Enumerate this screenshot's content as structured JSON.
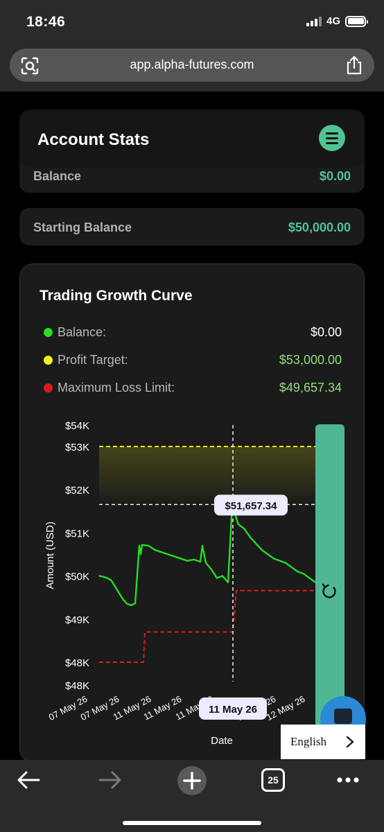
{
  "status_bar": {
    "time": "18:46",
    "network": "4G"
  },
  "browser": {
    "url": "app.alpha-futures.com",
    "tab_count": "25"
  },
  "header": {
    "title": "Account Stats"
  },
  "stats": [
    {
      "label": "Balance",
      "value": "$0.00"
    },
    {
      "label": "Starting Balance",
      "value": "$50,000.00"
    }
  ],
  "chart_card": {
    "title": "Trading Growth Curve",
    "legend": [
      {
        "label": "Balance:",
        "value": "$0.00",
        "dot_color": "#22e022",
        "value_color": "#ffffff"
      },
      {
        "label": "Profit Target:",
        "value": "$53,000.00",
        "dot_color": "#f2f21c",
        "value_color": "#8fe07a"
      },
      {
        "label": "Maximum Loss Limit:",
        "value": "$49,657.34",
        "dot_color": "#e01818",
        "value_color": "#8fe07a"
      }
    ]
  },
  "chart_data": {
    "type": "line",
    "ylabel": "Amount (USD)",
    "xlabel": "Date",
    "ytick_labels": [
      "$54K",
      "$53K",
      "$52K",
      "$51K",
      "$50K",
      "$49K",
      "$48K",
      "$48K"
    ],
    "xtick_labels": [
      "07 May 26",
      "07 May 26",
      "11 May 26",
      "11 May 26",
      "11 May 26",
      "12 May 26",
      "12 May 26"
    ],
    "ylim": [
      48000,
      54000
    ],
    "profit_target": 53000,
    "series": [
      {
        "name": "Balance:",
        "color": "#22e022",
        "values": [
          50000,
          49980,
          49950,
          49900,
          49750,
          49600,
          49450,
          49350,
          49320,
          49360,
          50700,
          50500,
          50720,
          50700,
          50600,
          50550,
          50500,
          50450,
          50400,
          50350,
          50380,
          50330,
          50700,
          50300,
          50150,
          49950,
          50000,
          49850,
          51650,
          51200,
          51100,
          50900,
          50750,
          50600,
          50500,
          50400,
          50350,
          50300,
          50200,
          50100,
          50050,
          49950,
          49850
        ]
      },
      {
        "name": "Maximum Loss Limit:",
        "color": "#e01818",
        "values": [
          48000,
          48000,
          48700,
          48700,
          48700,
          49657.34,
          49657.34,
          49657.34
        ]
      }
    ],
    "tooltip": {
      "value_label": "$51,657.34",
      "date_label": "11 May 26",
      "value": 51657.34
    },
    "grid": false,
    "legend_placement": "top-left"
  },
  "language": {
    "label": "English"
  },
  "colors": {
    "accent": "#4fc393",
    "background": "#000000",
    "card": "#1b1b1b"
  },
  "icons": {
    "menu": "hamburger-icon",
    "scan": "scan-icon",
    "share": "share-icon",
    "back": "back-arrow-icon",
    "forward": "forward-arrow-icon",
    "new_tab": "plus-icon",
    "more": "more-dots-icon",
    "refresh": "refresh-icon",
    "chat": "chat-icon",
    "language_next": "chevron-right-icon"
  }
}
